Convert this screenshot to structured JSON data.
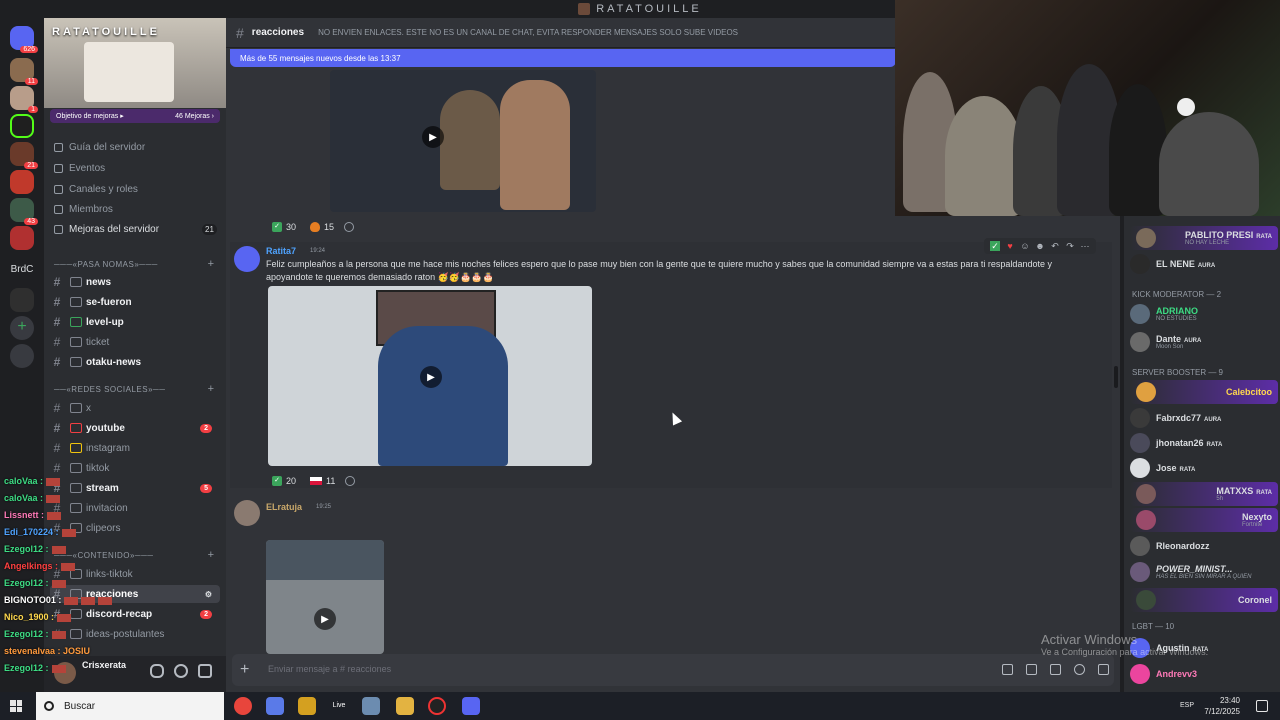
{
  "window": {
    "title": "RATATOUILLE"
  },
  "rail": {
    "badges": [
      "626",
      "11",
      "1",
      "21",
      "43"
    ],
    "label": "BrdC"
  },
  "server": {
    "name": "RATATOUILLE",
    "boost_goal": "Objetivo de mejoras ▸",
    "boost_count": "46 Mejoras ›",
    "menu": [
      "Guía del servidor",
      "Eventos",
      "Canales y roles",
      "Miembros",
      "Mejoras del servidor"
    ],
    "menu_badge": "21"
  },
  "categories": [
    {
      "name": "───«PASA NOMAS»───"
    },
    {
      "name": "──«REDES SOCIALES»──"
    },
    {
      "name": "───«CONTENIDO»───"
    }
  ],
  "channels": [
    {
      "name": "news",
      "unread": true
    },
    {
      "name": "se-fueron",
      "unread": true
    },
    {
      "name": "level-up",
      "unread": true
    },
    {
      "name": "ticket",
      "unread": false
    },
    {
      "name": "otaku-news",
      "unread": true
    },
    {
      "name": "x",
      "unread": false
    },
    {
      "name": "youtube",
      "unread": true,
      "badge": "2"
    },
    {
      "name": "instagram",
      "unread": false
    },
    {
      "name": "tiktok",
      "unread": false
    },
    {
      "name": "stream",
      "unread": true,
      "badge": "5"
    },
    {
      "name": "invitacion",
      "unread": false
    },
    {
      "name": "clipeors",
      "unread": false
    },
    {
      "name": "links-tiktok",
      "unread": false
    },
    {
      "name": "reacciones",
      "unread": true,
      "active": true
    },
    {
      "name": "discord-recap",
      "unread": true,
      "badge": "2"
    },
    {
      "name": "ideas-postulantes",
      "unread": false
    }
  ],
  "user": {
    "name": "Crisxerata"
  },
  "stream_chat": [
    {
      "name": "caloVaa :",
      "color": "#3ddc84"
    },
    {
      "name": "caloVaa :",
      "color": "#3ddc84"
    },
    {
      "name": "Lissnett :",
      "color": "#ff7ab8"
    },
    {
      "name": "Edi_170224 :",
      "color": "#4fa3ff"
    },
    {
      "name": "Ezegol12 :",
      "color": "#3ddc84"
    },
    {
      "name": "Angelkings :",
      "color": "#ff4040"
    },
    {
      "name": "Ezegol12 :",
      "color": "#3ddc84"
    },
    {
      "name": "BIGNOTO01 :",
      "color": "#ffffff"
    },
    {
      "name": "Nico_1900 :",
      "color": "#ffd84d"
    },
    {
      "name": "Ezegol12 :",
      "color": "#3ddc84"
    },
    {
      "name": "stevenalvaa : JOSIU",
      "color": "#ff9a3d"
    },
    {
      "name": "Ezegol12 :",
      "color": "#3ddc84"
    }
  ],
  "header": {
    "channel": "reacciones",
    "topic": "NO ENVIEN ENLACES. ESTE NO ES UN CANAL DE CHAT, EVITA RESPONDER MENSAJES SOLO SUBE VIDEOS"
  },
  "new_messages": "Más de 55 mensajes nuevos desde las 13:37",
  "messages": [
    {
      "reactions": [
        {
          "emoji": "check",
          "count": "30"
        },
        {
          "emoji": "fire",
          "count": "15"
        }
      ]
    },
    {
      "author": "Ratita7",
      "time": "19:24",
      "text": "Feliz cumpleaños a la persona que me hace mis noches felices espero que lo pase muy bien con la gente que te quiere mucho y sabes que la comunidad siempre va a estas para ti respaldandote y apoyandote te queremos demasiado raton 🥳🥳🎂🎂🎂",
      "reactions": [
        {
          "emoji": "check",
          "count": "20"
        },
        {
          "emoji": "flag",
          "count": "11"
        }
      ]
    },
    {
      "author": "ELratuja",
      "time": "19:25"
    }
  ],
  "composer": {
    "placeholder": "Enviar mensaje a #",
    "channel": "reacciones"
  },
  "member_categories": [
    "KICK MODERATOR — 2",
    "SERVER BOOSTER — 9",
    "LGBT — 10"
  ],
  "members": [
    {
      "name": "PABLITO PRESI",
      "tag": "RATA",
      "sub": "NO HAY LECHE",
      "color": "#dbdee1"
    },
    {
      "name": "EL NENE",
      "tag": "AURA",
      "sub": "",
      "color": "#dbdee1"
    },
    {
      "name": "ADRIANO",
      "tag": "",
      "sub": "NO ESTUDIES",
      "color": "#3ddc84"
    },
    {
      "name": "Dante",
      "tag": "AURA",
      "sub": "Moon Son",
      "color": "#dbdee1"
    },
    {
      "name": "Calebcitoo",
      "tag": "",
      "sub": "",
      "color": "#ffd84d"
    },
    {
      "name": "Fabrxdc77",
      "tag": "AURA",
      "sub": "",
      "color": "#dbdee1"
    },
    {
      "name": "jhonatan26",
      "tag": "RATA",
      "sub": "",
      "color": "#dbdee1"
    },
    {
      "name": "Jose",
      "tag": "RATA",
      "sub": "",
      "color": "#dbdee1"
    },
    {
      "name": "MATXXS",
      "tag": "RATA",
      "sub": "5h",
      "color": "#dbdee1"
    },
    {
      "name": "Nexyto",
      "tag": "",
      "sub": "Fortnite",
      "color": "#dbdee1"
    },
    {
      "name": "Rleonardozz",
      "tag": "",
      "sub": "",
      "color": "#dbdee1"
    },
    {
      "name": "POWER_MINIST...",
      "tag": "",
      "sub": "HAS EL BIEN SIN MIRAR A QUIEN",
      "color": "#dbdee1"
    },
    {
      "name": "Coronel",
      "tag": "",
      "sub": "",
      "color": "#dbdee1"
    },
    {
      "name": "Agustin",
      "tag": "RATA",
      "sub": "",
      "color": "#dbdee1"
    },
    {
      "name": "Andrevv3",
      "tag": "",
      "sub": "",
      "color": "#ff7ab8"
    }
  ],
  "watermark": {
    "line1": "Activar Windows",
    "line2": "Ve a Configuración para activar Windows."
  },
  "taskbar": {
    "search": "Buscar",
    "time": "23:40",
    "date": "7/12/2025",
    "lang": "ESP",
    "live": "Live"
  },
  "colors": {
    "accent": "#5865f2",
    "danger": "#f23f43",
    "green": "#3ba55c"
  }
}
